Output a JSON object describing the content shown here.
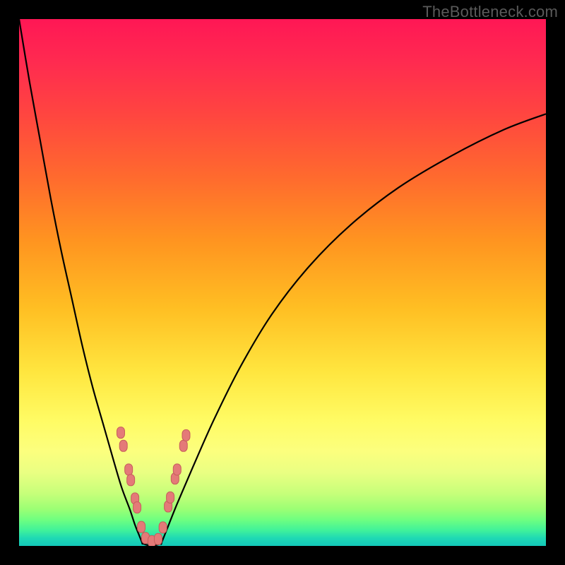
{
  "watermark": "TheBottleneck.com",
  "colors": {
    "frame": "#000000",
    "curve": "#000000",
    "bead_fill": "#e47a78",
    "bead_stroke": "#c65e5c"
  },
  "chart_data": {
    "type": "line",
    "title": "",
    "xlabel": "",
    "ylabel": "",
    "xlim": [
      0,
      100
    ],
    "ylim": [
      0,
      100
    ],
    "series": [
      {
        "name": "left-branch",
        "x": [
          0,
          2,
          4,
          6,
          8,
          10,
          12,
          14,
          16,
          18,
          19.5,
          21,
          22,
          22.8,
          23.4
        ],
        "y": [
          100,
          88,
          77,
          66,
          56,
          47,
          38,
          30,
          23,
          16,
          11,
          7,
          4,
          2,
          0.5
        ]
      },
      {
        "name": "valley-floor",
        "x": [
          23.4,
          24.2,
          25.2,
          26.2,
          27.0
        ],
        "y": [
          0.5,
          0.2,
          0.1,
          0.2,
          0.5
        ]
      },
      {
        "name": "right-branch",
        "x": [
          27.0,
          28,
          30,
          33,
          37,
          42,
          48,
          55,
          63,
          72,
          82,
          92,
          100
        ],
        "y": [
          0.5,
          3,
          8,
          15,
          24,
          34,
          44,
          53,
          61,
          68,
          74,
          79,
          82
        ]
      }
    ],
    "markers": {
      "name": "beads",
      "points": [
        {
          "x": 19.3,
          "y": 21.5
        },
        {
          "x": 19.8,
          "y": 19.0
        },
        {
          "x": 20.8,
          "y": 14.5
        },
        {
          "x": 21.2,
          "y": 12.5
        },
        {
          "x": 22.0,
          "y": 9.0
        },
        {
          "x": 22.4,
          "y": 7.3
        },
        {
          "x": 23.2,
          "y": 3.6
        },
        {
          "x": 24.0,
          "y": 1.5
        },
        {
          "x": 25.2,
          "y": 0.9
        },
        {
          "x": 26.4,
          "y": 1.3
        },
        {
          "x": 27.3,
          "y": 3.5
        },
        {
          "x": 28.3,
          "y": 7.5
        },
        {
          "x": 28.7,
          "y": 9.2
        },
        {
          "x": 29.6,
          "y": 12.8
        },
        {
          "x": 30.0,
          "y": 14.5
        },
        {
          "x": 31.2,
          "y": 19.0
        },
        {
          "x": 31.7,
          "y": 21.0
        }
      ]
    }
  }
}
